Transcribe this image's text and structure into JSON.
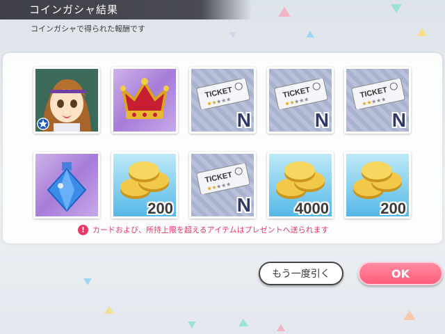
{
  "header": {
    "title": "コインガシャ結果",
    "subtitle": "コインガシャで得られた報酬です"
  },
  "items": [
    {
      "kind": "card",
      "icon": "idol-card-icon"
    },
    {
      "kind": "crown",
      "icon": "crown-icon"
    },
    {
      "kind": "ticket",
      "ticket_label": "TICKET",
      "rank": "N",
      "stars": 2,
      "icon": "ticket-icon"
    },
    {
      "kind": "ticket",
      "ticket_label": "TICKET",
      "rank": "N",
      "stars": 2,
      "icon": "ticket-icon"
    },
    {
      "kind": "ticket",
      "ticket_label": "TICKET",
      "rank": "N",
      "stars": 2,
      "icon": "ticket-icon"
    },
    {
      "kind": "potion",
      "icon": "blue-bottle-icon"
    },
    {
      "kind": "coin",
      "quantity": "200",
      "icon": "gold-coins-icon"
    },
    {
      "kind": "ticket",
      "ticket_label": "TICKET",
      "rank": "N",
      "stars": 2,
      "icon": "ticket-icon"
    },
    {
      "kind": "coin",
      "quantity": "4000",
      "icon": "gold-coins-icon"
    },
    {
      "kind": "coin",
      "quantity": "200",
      "icon": "gold-coins-icon"
    }
  ],
  "notice": {
    "text": "カードおよび、所持上限を超えるアイテムはプレゼントへ送られます",
    "icon": "exclamation-icon"
  },
  "buttons": {
    "again_label": "もう一度引く",
    "ok_label": "OK"
  },
  "colors": {
    "accent": "#ff5d7b",
    "notice": "#e63765",
    "header": "#3f4047"
  }
}
